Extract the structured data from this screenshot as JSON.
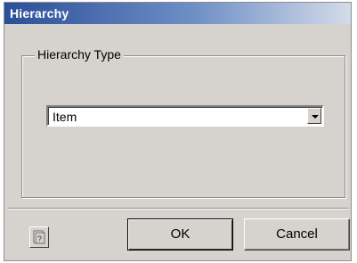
{
  "window": {
    "title": "Hierarchy"
  },
  "group": {
    "legend": "Hierarchy Type"
  },
  "hierarchy_type_combo": {
    "selected_value": "Item"
  },
  "buttons": {
    "ok_label": "OK",
    "cancel_label": "Cancel"
  },
  "icons": {
    "help": "help-icon",
    "dropdown": "chevron-down-icon"
  },
  "colors": {
    "titlebar_start": "#2b4f98",
    "dialog_bg": "#d6d3ce"
  }
}
